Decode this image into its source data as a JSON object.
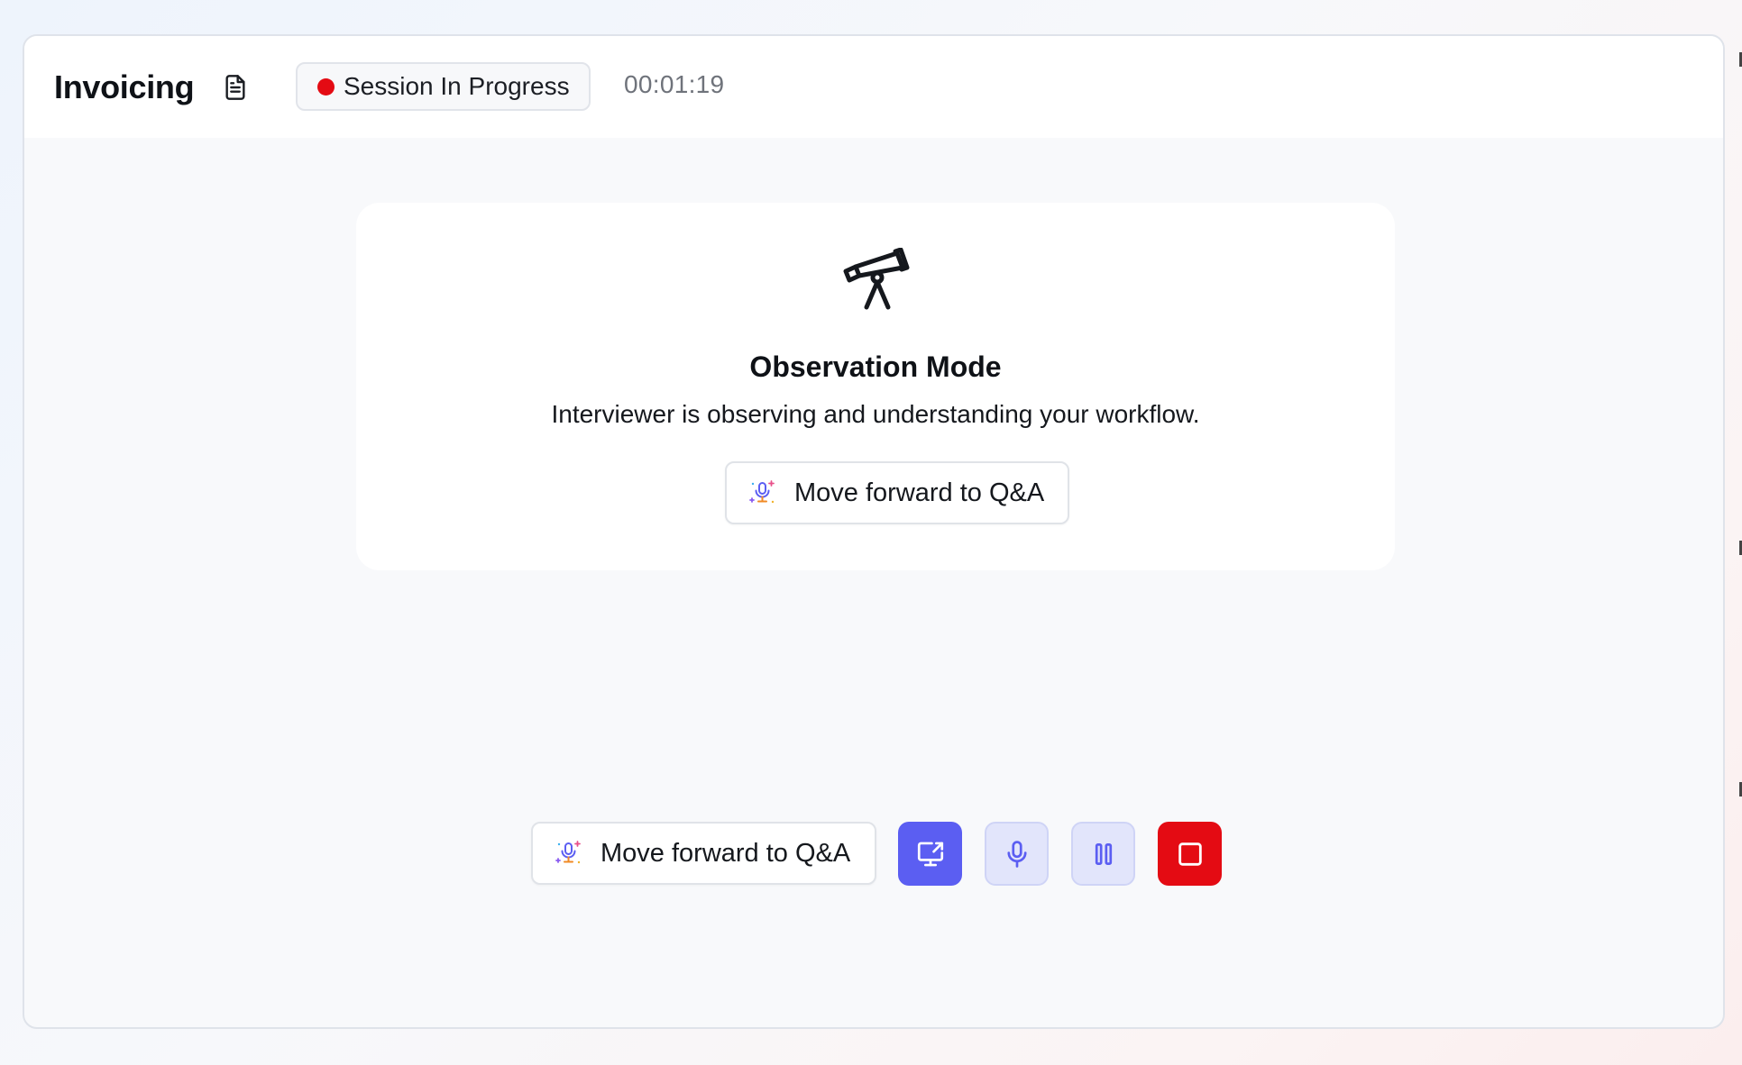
{
  "header": {
    "title": "Invoicing",
    "doc_icon": "document-icon",
    "status_label": "Session In Progress",
    "status_color": "#e40b13",
    "timer": "00:01:19"
  },
  "observation_card": {
    "icon": "telescope-icon",
    "title": "Observation Mode",
    "description": "Interviewer is observing and understanding your workflow.",
    "button_label": "Move forward to Q&A",
    "button_icon": "sparkle-mic-icon"
  },
  "control_bar": {
    "qa_button_label": "Move forward to Q&A",
    "qa_button_icon": "sparkle-mic-icon",
    "buttons": [
      {
        "name": "share-screen",
        "icon": "monitor-share-icon",
        "color": "#5b5ef2"
      },
      {
        "name": "microphone",
        "icon": "microphone-icon",
        "color": "#e2e5fb"
      },
      {
        "name": "pause",
        "icon": "pause-icon",
        "color": "#e2e5fb"
      },
      {
        "name": "stop",
        "icon": "stop-icon",
        "color": "#e40b13"
      }
    ]
  },
  "colors": {
    "accent": "#5b5ef2",
    "danger": "#e40b13",
    "surface": "#ffffff",
    "background": "#f8f9fb"
  }
}
